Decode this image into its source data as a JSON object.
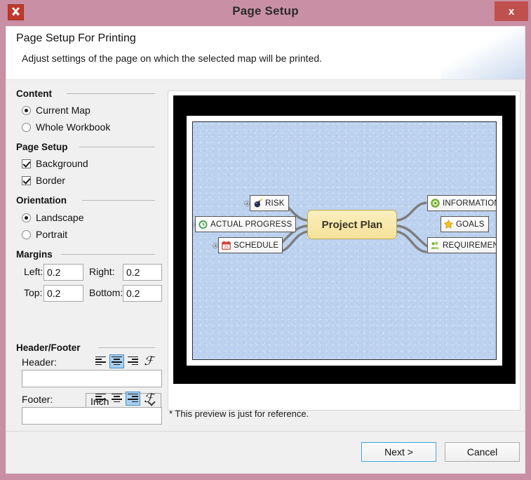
{
  "window": {
    "title": "Page Setup",
    "app_icon": "xmind-icon",
    "close_label": "x"
  },
  "header": {
    "title": "Page Setup For Printing",
    "subtitle": "Adjust settings of the page on which the selected map will be printed."
  },
  "settings": {
    "content": {
      "heading": "Content",
      "options": [
        {
          "label": "Current Map",
          "selected": true
        },
        {
          "label": "Whole Workbook",
          "selected": false
        }
      ]
    },
    "page_setup": {
      "heading": "Page Setup",
      "options": [
        {
          "label": "Background",
          "checked": true
        },
        {
          "label": "Border",
          "checked": true
        }
      ]
    },
    "orientation": {
      "heading": "Orientation",
      "options": [
        {
          "label": "Landscape",
          "selected": true
        },
        {
          "label": "Portrait",
          "selected": false
        }
      ]
    },
    "margins": {
      "heading": "Margins",
      "left_label": "Left:",
      "left_value": "0.2",
      "right_label": "Right:",
      "right_value": "0.2",
      "top_label": "Top:",
      "top_value": "0.2",
      "bottom_label": "Bottom:",
      "bottom_value": "0.2",
      "unit_value": "Inch"
    },
    "header_footer": {
      "heading": "Header/Footer",
      "header_label": "Header:",
      "header_value": "",
      "header_placeholder": "",
      "header_alignment": "center",
      "footer_label": "Footer:",
      "footer_value": "",
      "footer_placeholder": "",
      "footer_alignment": "right",
      "font_button": "font-format-icon"
    }
  },
  "preview": {
    "note": "* This preview is just for reference.",
    "page_background": "#bcd2ef",
    "frame_color": "#000000"
  },
  "map": {
    "central": {
      "label": "Project Plan",
      "fill": "#f5e29a"
    },
    "nodes": [
      {
        "label": "RISK",
        "icon": "bomb-icon",
        "side": "left"
      },
      {
        "label": "ACTUAL PROGRESS",
        "icon": "clock-icon",
        "side": "left"
      },
      {
        "label": "SCHEDULE",
        "icon": "calendar-icon",
        "side": "left"
      },
      {
        "label": "INFORMATION",
        "icon": "play-circle-icon",
        "side": "right"
      },
      {
        "label": "GOALS",
        "icon": "star-icon",
        "side": "right"
      },
      {
        "label": "REQUIREMENTS",
        "icon": "people-icon",
        "side": "right"
      }
    ]
  },
  "buttons": {
    "next_label": "Next >",
    "cancel_label": "Cancel"
  }
}
